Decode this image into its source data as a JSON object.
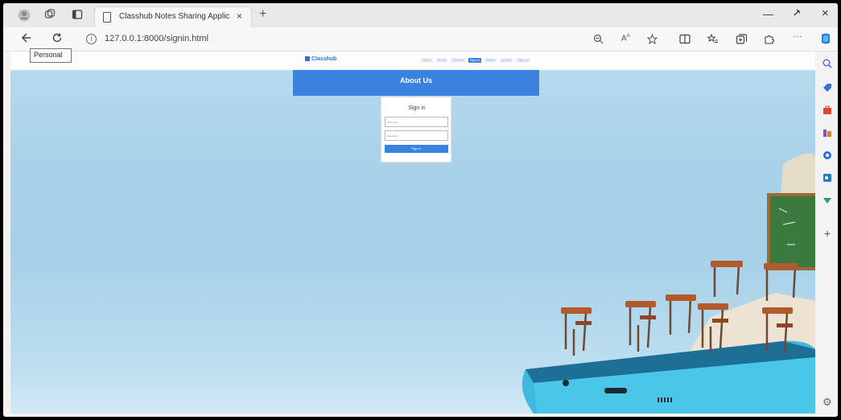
{
  "browser": {
    "tab_title": "Classhub  Notes Sharing Applic",
    "tab_close": "×",
    "new_tab": "+",
    "url": "127.0.0.1:8000/signin.html",
    "tooltip": "Personal",
    "controls": {
      "minimize": "—",
      "pin": "⊖",
      "close": "×"
    },
    "icons": {
      "profile": "profile-icon",
      "workspaces": "workspaces-icon",
      "tab-actions": "tab-actions-icon",
      "back": "back-arrow-icon",
      "info": "info-icon",
      "zoom": "zoom-icon",
      "read-aloud": "read-aloud-icon",
      "favorite": "star-icon",
      "split": "split-screen-icon",
      "favorites": "favorites-icon",
      "collections": "collections-icon",
      "extensions": "extensions-icon",
      "more": "more-icon",
      "copilot": "copilot-icon"
    }
  },
  "page": {
    "brand": "Classhub",
    "nav_links": [
      "Home",
      "About",
      "Contact",
      "Sign in",
      "Notes",
      "Upload",
      "Sign up"
    ],
    "active_nav_index": 3,
    "about": {
      "title": "About Us",
      "text": ""
    },
    "signin": {
      "title": "Sign in",
      "username_placeholder": "Username",
      "password_placeholder": "Password",
      "button_label": "Sign in",
      "link_text": ""
    }
  },
  "sidebar": {
    "icons": [
      "search-icon",
      "tag-icon",
      "briefcase-icon",
      "games-icon",
      "office-icon",
      "outlook-icon",
      "tools-icon"
    ],
    "colors": [
      "#4a6cd0",
      "#3b6fd8",
      "#d94a2b",
      "#8a4cc7",
      "#2f6bd6",
      "#1f7fc6",
      "#2a9d68"
    ],
    "add": "+",
    "settings": "⚙"
  }
}
